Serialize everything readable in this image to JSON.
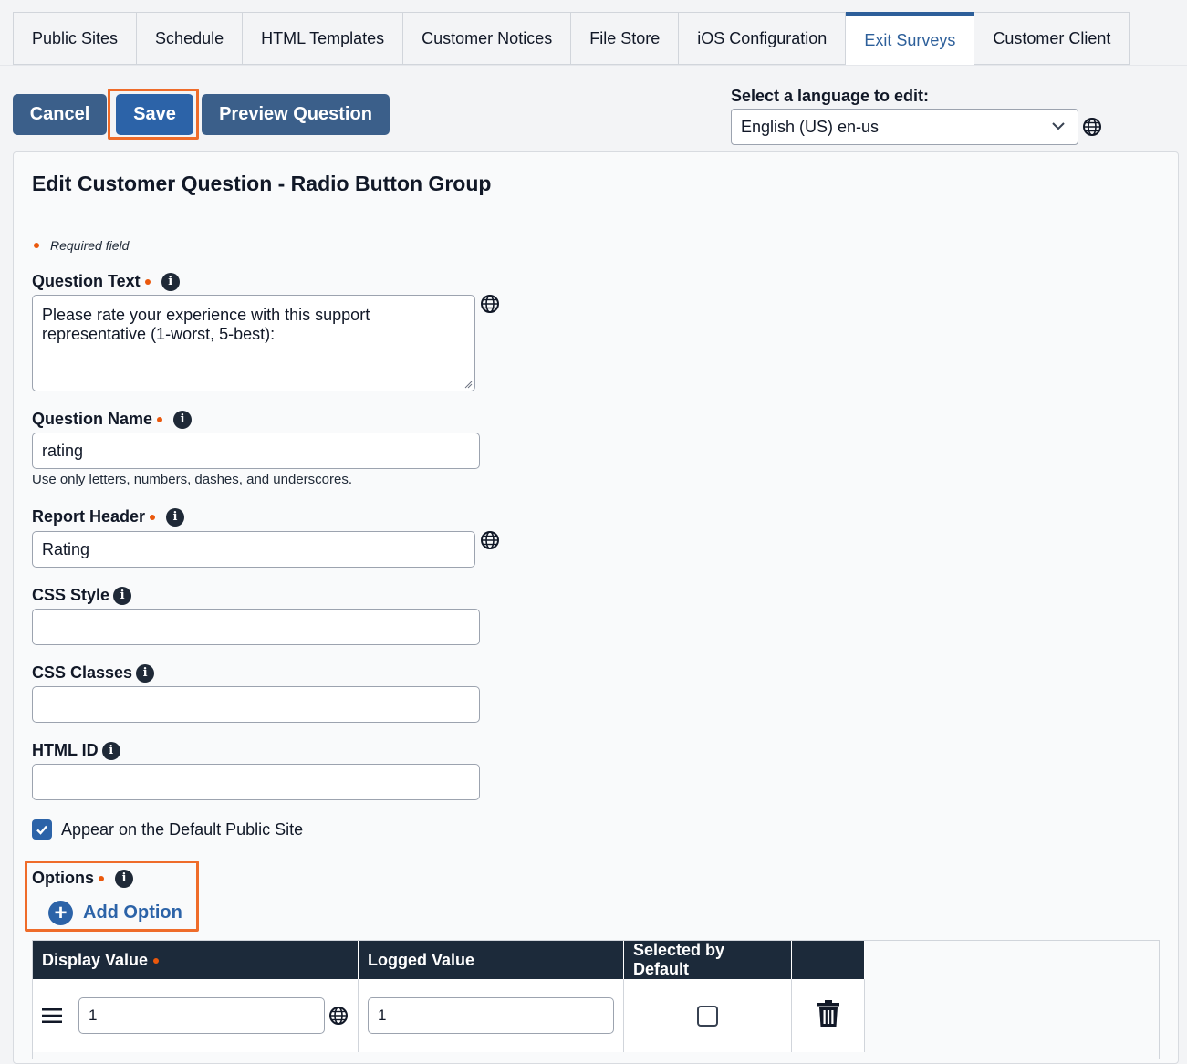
{
  "tabs": [
    {
      "label": "Public Sites"
    },
    {
      "label": "Schedule"
    },
    {
      "label": "HTML Templates"
    },
    {
      "label": "Customer Notices"
    },
    {
      "label": "File Store"
    },
    {
      "label": "iOS Configuration"
    },
    {
      "label": "Exit Surveys",
      "active": true
    },
    {
      "label": "Customer Client"
    }
  ],
  "toolbar": {
    "cancel_label": "Cancel",
    "save_label": "Save",
    "preview_label": "Preview Question"
  },
  "language": {
    "label": "Select a language to edit:",
    "selected": "English (US) en-us"
  },
  "form": {
    "title": "Edit Customer Question - Radio Button Group",
    "required_note": "Required field",
    "question_text": {
      "label": "Question Text",
      "value": "Please rate your experience with this support representative (1-worst, 5-best):"
    },
    "question_name": {
      "label": "Question Name",
      "value": "rating",
      "help": "Use only letters, numbers, dashes, and underscores."
    },
    "report_header": {
      "label": "Report Header",
      "value": "Rating"
    },
    "css_style": {
      "label": "CSS Style",
      "value": ""
    },
    "css_classes": {
      "label": "CSS Classes",
      "value": ""
    },
    "html_id": {
      "label": "HTML ID",
      "value": ""
    },
    "appear_default": {
      "label": "Appear on the Default Public Site",
      "checked": true
    },
    "options": {
      "label": "Options",
      "add_label": "Add Option"
    }
  },
  "options_table": {
    "columns": [
      "Display Value",
      "Logged Value",
      "Selected by Default",
      ""
    ],
    "rows": [
      {
        "display_value": "1",
        "logged_value": "1",
        "selected": false
      }
    ]
  },
  "colors": {
    "accent": "#2c63a8",
    "button": "#3b5f8a",
    "highlight": "#ef6c2a",
    "table_header": "#1c2a3a",
    "required_dot": "#ea580c"
  },
  "icons": {
    "globe": "globe-icon",
    "info": "info-icon",
    "drag": "drag-handle-icon",
    "trash": "trash-icon",
    "chevron": "chevron-down-icon"
  }
}
